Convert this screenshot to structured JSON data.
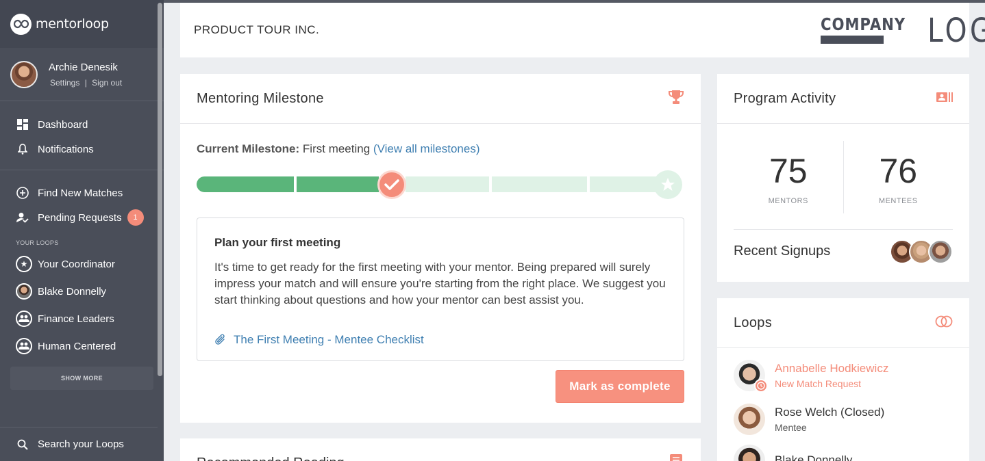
{
  "brand": {
    "name": "mentorloop"
  },
  "user": {
    "name": "Archie Denesik",
    "settings": "Settings",
    "separator": "|",
    "signout": "Sign out"
  },
  "nav": {
    "dashboard": "Dashboard",
    "notifications": "Notifications",
    "find_matches": "Find New Matches",
    "pending_requests": "Pending Requests",
    "pending_count": "1"
  },
  "loops_section": {
    "label": "YOUR LOOPS",
    "items": [
      "Your Coordinator",
      "Blake Donnelly",
      "Finance Leaders",
      "Human Centered"
    ],
    "show_more": "SHOW MORE",
    "search": "Search your Loops"
  },
  "header": {
    "company": "PRODUCT TOUR INC.",
    "logo_top": "COMPANY",
    "logo_main": "LOGO"
  },
  "milestone": {
    "title": "Mentoring Milestone",
    "current_label": "Current Milestone:",
    "current_value": "First meeting",
    "view_all": "(View all milestones)",
    "progress_completed_segments": 2,
    "progress_total_segments": 5,
    "task_title": "Plan your first meeting",
    "task_desc": "It's time to get ready for the first meeting with your mentor. Being prepared will surely impress your match and will ensure you're starting from the right place. We suggest you start thinking about questions and how your mentor can best assist you.",
    "attachment": "The First Meeting - Mentee Checklist",
    "mark_complete": "Mark as complete"
  },
  "reading": {
    "title": "Recommended Reading"
  },
  "activity": {
    "title": "Program Activity",
    "mentors_count": "75",
    "mentors_label": "MENTORS",
    "mentees_count": "76",
    "mentees_label": "MENTEES",
    "recent_signups": "Recent Signups"
  },
  "loops": {
    "title": "Loops",
    "items": [
      {
        "name": "Annabelle Hodkiewicz",
        "sub": "New Match Request"
      },
      {
        "name": "Rose Welch (Closed)",
        "sub": "Mentee"
      },
      {
        "name": "Blake Donnelly",
        "sub": ""
      }
    ]
  },
  "colors": {
    "accent": "#f7917f",
    "link": "#3f7fb1",
    "progress_done": "#5ab57a",
    "progress_todo": "#dff2e6",
    "sidebar": "#4a4e59"
  }
}
